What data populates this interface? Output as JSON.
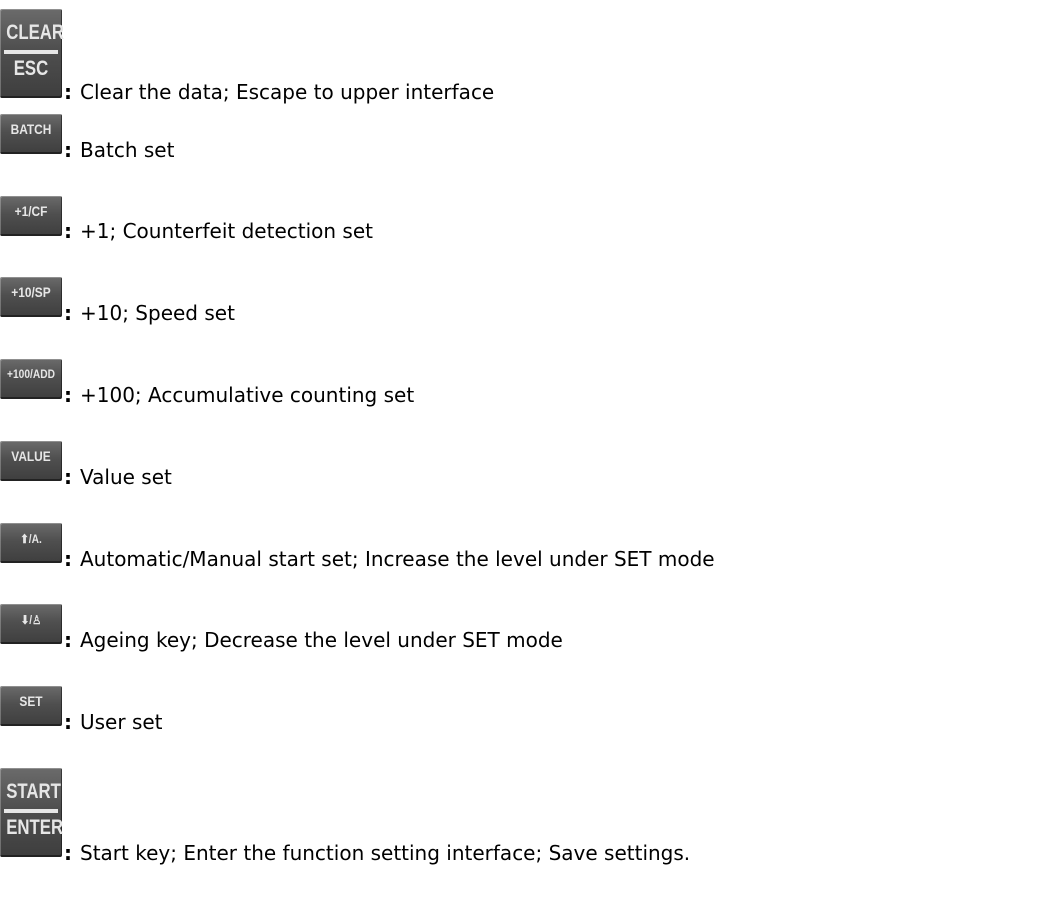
{
  "keys": [
    {
      "top": "CLEAR",
      "bottom": "ESC",
      "desc": "Clear the data; Escape to upper interface"
    },
    {
      "label": "BATCH",
      "desc": "Batch set"
    },
    {
      "label": "+1/CF",
      "desc": "+1; Counterfeit detection set"
    },
    {
      "label": "+10/SP",
      "desc": "+10; Speed set"
    },
    {
      "label": "+100/ADD",
      "desc": "+100; Accumulative counting set"
    },
    {
      "label": "VALUE",
      "desc": "Value set"
    },
    {
      "label": "⬆/A.",
      "desc": "Automatic/Manual start set; Increase the level under SET mode"
    },
    {
      "label": "⬇/♙",
      "desc": "Ageing key; Decrease the level under SET mode"
    },
    {
      "label": "SET",
      "desc": "User set"
    },
    {
      "top": "START",
      "bottom": "ENTER",
      "desc": "Start key; Enter the function setting interface; Save settings."
    }
  ],
  "separator": ":"
}
